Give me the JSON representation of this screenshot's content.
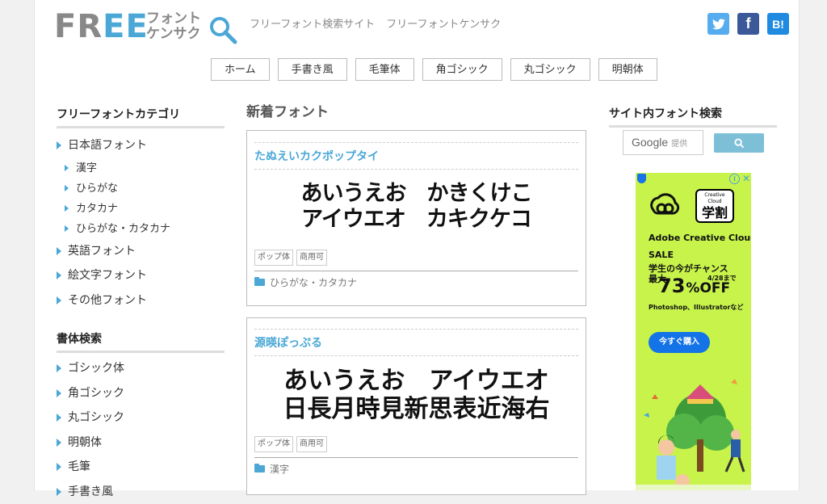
{
  "header": {
    "logo_main": "FREE",
    "logo_sub_1": "フォント",
    "logo_sub_2": "ケンサク",
    "tagline_1": "フリーフォント検索サイト",
    "tagline_2": "フリーフォントケンサク",
    "social": [
      {
        "name": "twitter-icon",
        "glyph": "🐦"
      },
      {
        "name": "facebook-icon",
        "glyph": "f"
      },
      {
        "name": "hatena-bookmark-icon",
        "glyph": "B!"
      }
    ]
  },
  "nav": [
    "ホーム",
    "手書き風",
    "毛筆体",
    "角ゴシック",
    "丸ゴシック",
    "明朝体"
  ],
  "sidebar": {
    "categories_title": "フリーフォントカテゴリ",
    "categories": [
      {
        "label": "日本語フォント",
        "level": 1
      },
      {
        "label": "漢字",
        "level": 2
      },
      {
        "label": "ひらがな",
        "level": 2
      },
      {
        "label": "カタカナ",
        "level": 2
      },
      {
        "label": "ひらがな・カタカナ",
        "level": 2
      },
      {
        "label": "英語フォント",
        "level": 1
      },
      {
        "label": "絵文字フォント",
        "level": 1
      },
      {
        "label": "その他フォント",
        "level": 1
      }
    ],
    "styles_title": "書体検索",
    "styles": [
      "ゴシック体",
      "角ゴシック",
      "丸ゴシック",
      "明朝体",
      "毛筆",
      "手書き風"
    ]
  },
  "main": {
    "title": "新着フォント",
    "cards": [
      {
        "title": "たぬえいカクポップタイ",
        "sample_line_1": "あいうえお　かきくけこ",
        "sample_line_2": "アイウエオ　カキクケコ",
        "tags": [
          "ポップ体",
          "商用可"
        ],
        "category": "ひらがな・カタカナ"
      },
      {
        "title": "源暎ぽっぷる",
        "sample_line_1": "あいうえお　アイウエオ",
        "sample_line_2": "日長月時見新思表近海右",
        "tags": [
          "ポップ体",
          "商用可"
        ],
        "category": "漢字"
      }
    ]
  },
  "right": {
    "search_title": "サイト内フォント検索",
    "search_brand": "Google",
    "search_placeholder": "提供",
    "ad": {
      "badge_small": "Creative Cloud",
      "badge_big": "学割",
      "line1": "Adobe Creative Cloud",
      "line2": "SALE",
      "line3": "学生の今がチャンス",
      "max": "最大",
      "percent": "73",
      "off": "%OFF",
      "date": "4/28まで",
      "line5": "Photoshop、Illustratorなど",
      "cta": "今すぐ購入"
    }
  },
  "colors": {
    "accent": "#4aa7d6",
    "twitter": "#55acee",
    "facebook": "#3b5998",
    "hatena": "#1f8ae0",
    "ad_bg": "#c7f34b",
    "ad_button": "#1473e6"
  }
}
